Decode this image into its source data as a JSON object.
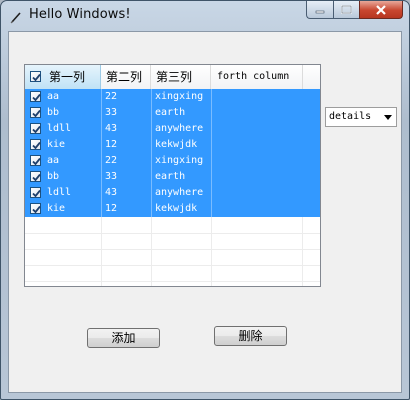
{
  "window": {
    "title": "Hello Windows!",
    "icon": "pen-icon"
  },
  "listview": {
    "columns": [
      "第一列",
      "第二列",
      "第三列",
      "forth column"
    ],
    "header_checked": true,
    "rows": [
      {
        "checked": true,
        "selected": true,
        "c1": "aa",
        "c2": "22",
        "c3": "xingxing",
        "c4": ""
      },
      {
        "checked": true,
        "selected": true,
        "c1": "bb",
        "c2": "33",
        "c3": "earth",
        "c4": ""
      },
      {
        "checked": true,
        "selected": true,
        "c1": "ldll",
        "c2": "43",
        "c3": "anywhere",
        "c4": ""
      },
      {
        "checked": true,
        "selected": true,
        "c1": "kie",
        "c2": "12",
        "c3": "kekwjdk",
        "c4": ""
      },
      {
        "checked": true,
        "selected": true,
        "c1": "aa",
        "c2": "22",
        "c3": "xingxing",
        "c4": ""
      },
      {
        "checked": true,
        "selected": true,
        "c1": "bb",
        "c2": "33",
        "c3": "earth",
        "c4": ""
      },
      {
        "checked": true,
        "selected": true,
        "c1": "ldll",
        "c2": "43",
        "c3": "anywhere",
        "c4": ""
      },
      {
        "checked": true,
        "selected": true,
        "c1": "kie",
        "c2": "12",
        "c3": "kekwjdk",
        "c4": ""
      }
    ]
  },
  "view_select": {
    "value": "details"
  },
  "buttons": {
    "add": "添加",
    "delete": "删除"
  },
  "colors": {
    "selection": "#3399ff",
    "client": "#f0f0f0",
    "close_button": "#c8462f"
  }
}
